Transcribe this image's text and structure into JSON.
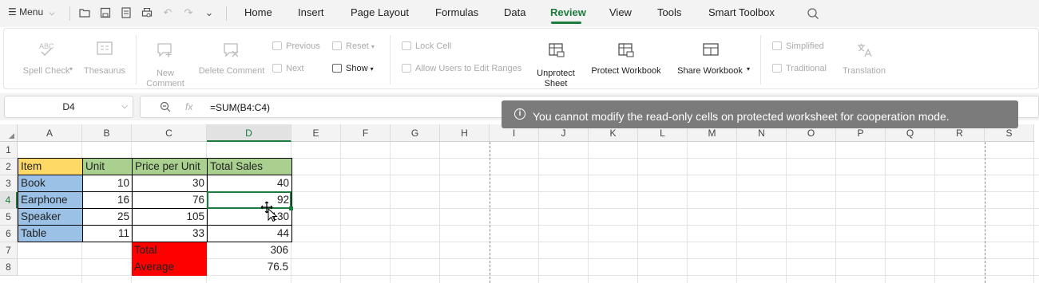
{
  "menubar": {
    "menu_label": "Menu",
    "tabs": [
      "Home",
      "Insert",
      "Page Layout",
      "Formulas",
      "Data",
      "Review",
      "View",
      "Tools",
      "Smart Toolbox"
    ],
    "active_tab": "Review"
  },
  "ribbon": {
    "spell_check": "Spell Check",
    "thesaurus": "Thesaurus",
    "new_comment_line1": "New",
    "new_comment_line2": "Comment",
    "delete_comment": "Delete Comment",
    "previous": "Previous",
    "next": "Next",
    "reset": "Reset",
    "show": "Show",
    "lock_cell": "Lock Cell",
    "allow_users": "Allow Users to Edit Ranges",
    "unprotect_line1": "Unprotect",
    "unprotect_line2": "Sheet",
    "protect_workbook": "Protect Workbook",
    "share_workbook": "Share Workbook",
    "simplified": "Simplified",
    "traditional": "Traditional",
    "translation": "Translation"
  },
  "formula_bar": {
    "name_box": "D4",
    "fx": "fx",
    "formula": "=SUM(B4:C4)"
  },
  "toast": {
    "message": "You cannot modify the read-only cells on protected worksheet for cooperation mode."
  },
  "sheet": {
    "columns": [
      "A",
      "B",
      "C",
      "D",
      "E",
      "F",
      "G",
      "H",
      "I",
      "J",
      "K",
      "L",
      "M",
      "N",
      "O",
      "P",
      "Q",
      "R",
      "S"
    ],
    "selected_column": "D",
    "rows": [
      "1",
      "2",
      "3",
      "4",
      "5",
      "6",
      "7",
      "8"
    ],
    "selected_row": "4",
    "headers": [
      "Item",
      "Unit",
      "Price per Unit",
      "Total Sales"
    ],
    "data": [
      [
        "Book",
        "10",
        "30",
        "40"
      ],
      [
        "Earphone",
        "16",
        "76",
        "92"
      ],
      [
        "Speaker",
        "25",
        "105",
        "130"
      ],
      [
        "Table",
        "11",
        "33",
        "44"
      ]
    ],
    "total_label": "Total",
    "total_value": "306",
    "average_label": "Average",
    "average_value": "76.5",
    "colors": {
      "item_header": "#ffd966",
      "other_header": "#a9d08e",
      "item_cells": "#9bc2e6",
      "summary_labels": "#ff0000",
      "selection": "#1b7a3e"
    }
  }
}
